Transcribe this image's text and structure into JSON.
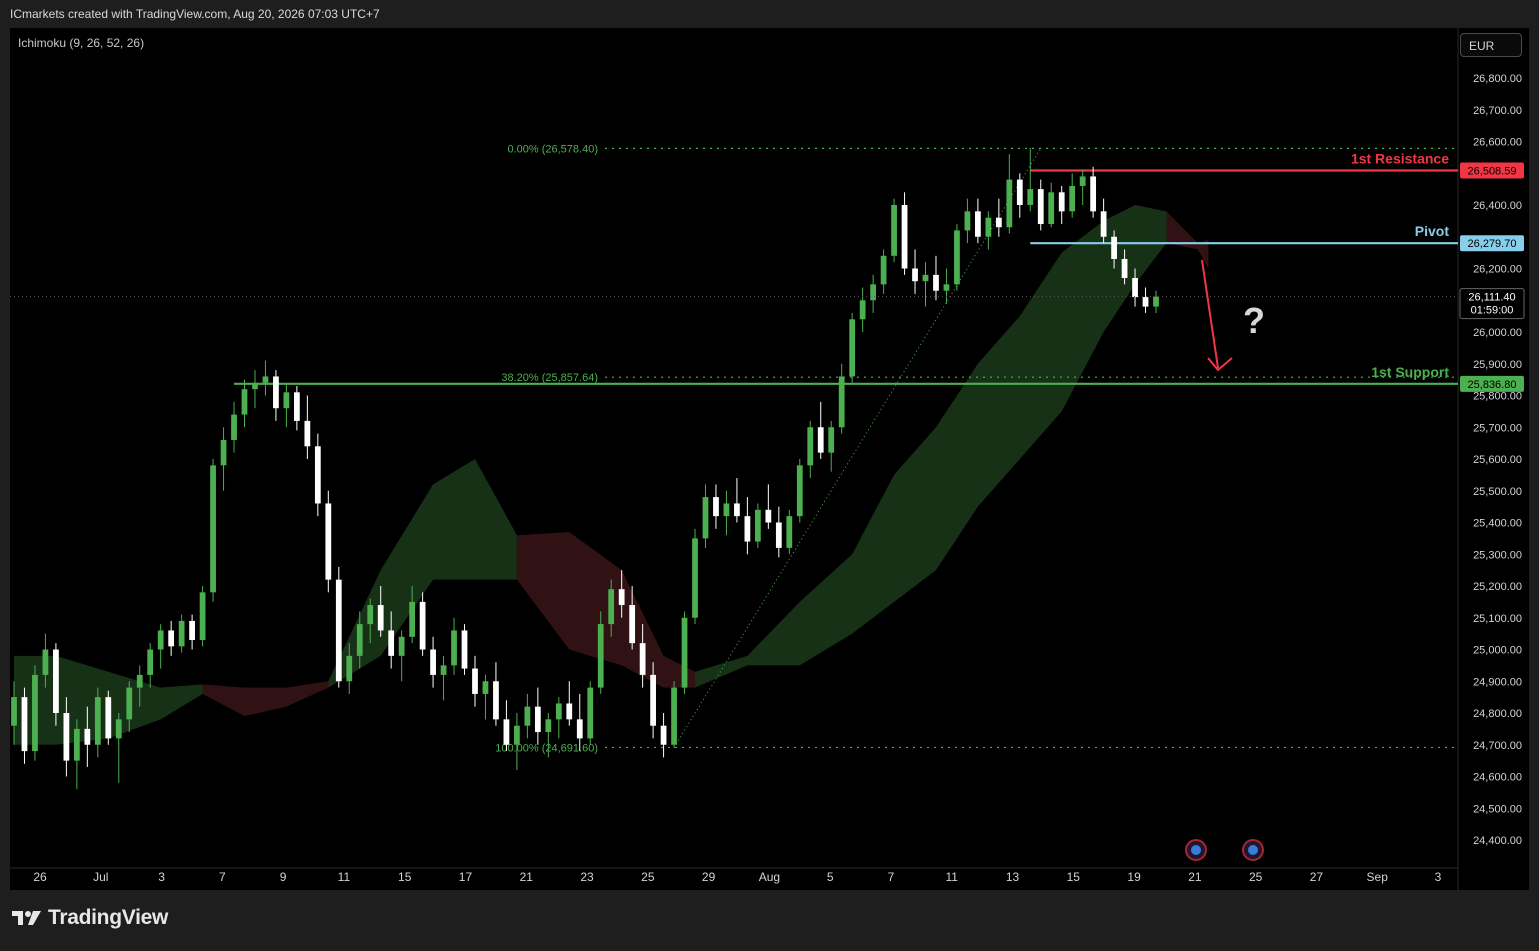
{
  "header": {
    "attribution": "ICmarkets created with TradingView.com, Aug 20, 2026 07:03 UTC+7",
    "indicator": "Ichimoku (9, 26, 52, 26)",
    "currency": "EUR"
  },
  "footer": {
    "brand": "TradingView"
  },
  "colors": {
    "up": "#4caf50",
    "down": "#ffffff",
    "resistance": "#f23645",
    "pivot": "#87ceeb",
    "support": "#4caf50",
    "fib": "#4caf50",
    "cloud_bull": "#1b3a1b",
    "cloud_bear": "#3a1518",
    "arrow": "#f23645"
  },
  "chart_data": {
    "type": "candlestick",
    "y_axis": {
      "ylim": [
        24300,
        26900
      ],
      "ticks": [
        24400,
        24500,
        24600,
        24700,
        24800,
        24900,
        25000,
        25100,
        25200,
        25300,
        25400,
        25500,
        25600,
        25700,
        25800,
        25900,
        26000,
        26100,
        26200,
        26300,
        26400,
        26500,
        26600,
        26700,
        26800
      ]
    },
    "x_axis": {
      "tick_labels": [
        "26",
        "Jul",
        "3",
        "7",
        "9",
        "11",
        "15",
        "17",
        "21",
        "23",
        "25",
        "29",
        "Aug",
        "5",
        "7",
        "11",
        "13",
        "15",
        "19",
        "21",
        "25",
        "27",
        "Sep",
        "3"
      ]
    },
    "levels": [
      {
        "label": "1st Resistance",
        "value": 26508.59,
        "value_text": "26,508.59"
      },
      {
        "label": "Pivot",
        "value": 26279.7,
        "value_text": "26,279.70"
      },
      {
        "label": "1st Support",
        "value": 25836.8,
        "value_text": "25,836.80"
      }
    ],
    "fibonacci": [
      {
        "label": "0.00% (26,578.40)",
        "value": 26578.4
      },
      {
        "label": "38.20% (25,857.64)",
        "value": 25857.64
      },
      {
        "label": "100.00% (24,691.60)",
        "value": 24691.6
      }
    ],
    "last_price": {
      "value": 26111.4,
      "value_text": "26,111.40",
      "countdown": "01:59:00"
    },
    "annotation": "?",
    "candles": [
      [
        24760,
        24900,
        24700,
        24850
      ],
      [
        24850,
        24880,
        24640,
        24680
      ],
      [
        24680,
        24950,
        24650,
        24920
      ],
      [
        24920,
        25050,
        24880,
        25000
      ],
      [
        25000,
        25020,
        24760,
        24800
      ],
      [
        24800,
        24850,
        24600,
        24650
      ],
      [
        24650,
        24780,
        24560,
        24750
      ],
      [
        24750,
        24820,
        24630,
        24700
      ],
      [
        24700,
        24880,
        24660,
        24850
      ],
      [
        24850,
        24870,
        24700,
        24720
      ],
      [
        24720,
        24800,
        24580,
        24780
      ],
      [
        24780,
        24900,
        24740,
        24880
      ],
      [
        24880,
        24950,
        24820,
        24920
      ],
      [
        24920,
        25020,
        24880,
        25000
      ],
      [
        25000,
        25080,
        24940,
        25060
      ],
      [
        25060,
        25090,
        24980,
        25010
      ],
      [
        25010,
        25110,
        24990,
        25090
      ],
      [
        25090,
        25110,
        25000,
        25030
      ],
      [
        25030,
        25200,
        25010,
        25180
      ],
      [
        25180,
        25600,
        25150,
        25580
      ],
      [
        25580,
        25700,
        25500,
        25660
      ],
      [
        25660,
        25780,
        25620,
        25740
      ],
      [
        25740,
        25850,
        25700,
        25820
      ],
      [
        25820,
        25880,
        25760,
        25840
      ],
      [
        25840,
        25910,
        25800,
        25860
      ],
      [
        25860,
        25880,
        25720,
        25760
      ],
      [
        25760,
        25840,
        25700,
        25810
      ],
      [
        25810,
        25830,
        25690,
        25720
      ],
      [
        25720,
        25800,
        25600,
        25640
      ],
      [
        25640,
        25680,
        25420,
        25460
      ],
      [
        25460,
        25500,
        25180,
        25220
      ],
      [
        25220,
        25260,
        24880,
        24900
      ],
      [
        24900,
        25020,
        24860,
        24980
      ],
      [
        24980,
        25120,
        24940,
        25080
      ],
      [
        25080,
        25160,
        25020,
        25140
      ],
      [
        25140,
        25200,
        25040,
        25060
      ],
      [
        25060,
        25120,
        24940,
        24980
      ],
      [
        24980,
        25060,
        24900,
        25040
      ],
      [
        25040,
        25200,
        25020,
        25150
      ],
      [
        25150,
        25180,
        24980,
        25000
      ],
      [
        25000,
        25040,
        24880,
        24920
      ],
      [
        24920,
        24980,
        24840,
        24950
      ],
      [
        24950,
        25100,
        24920,
        25060
      ],
      [
        25060,
        25080,
        24920,
        24940
      ],
      [
        24940,
        24980,
        24820,
        24860
      ],
      [
        24860,
        24920,
        24780,
        24900
      ],
      [
        24900,
        24960,
        24760,
        24780
      ],
      [
        24780,
        24840,
        24680,
        24700
      ],
      [
        24700,
        24800,
        24620,
        24760
      ],
      [
        24760,
        24860,
        24720,
        24820
      ],
      [
        24820,
        24880,
        24700,
        24740
      ],
      [
        24740,
        24800,
        24660,
        24780
      ],
      [
        24780,
        24850,
        24720,
        24830
      ],
      [
        24830,
        24900,
        24760,
        24780
      ],
      [
        24780,
        24860,
        24680,
        24720
      ],
      [
        24720,
        24900,
        24700,
        24880
      ],
      [
        24880,
        25120,
        24860,
        25080
      ],
      [
        25080,
        25220,
        25040,
        25190
      ],
      [
        25190,
        25250,
        25100,
        25140
      ],
      [
        25140,
        25200,
        25000,
        25020
      ],
      [
        25020,
        25080,
        24880,
        24920
      ],
      [
        24920,
        24960,
        24720,
        24760
      ],
      [
        24760,
        24800,
        24660,
        24700
      ],
      [
        24700,
        24900,
        24690,
        24880
      ],
      [
        24880,
        25120,
        24860,
        25100
      ],
      [
        25100,
        25380,
        25080,
        25350
      ],
      [
        25350,
        25520,
        25320,
        25480
      ],
      [
        25480,
        25520,
        25380,
        25420
      ],
      [
        25420,
        25500,
        25360,
        25460
      ],
      [
        25460,
        25540,
        25400,
        25420
      ],
      [
        25420,
        25480,
        25300,
        25340
      ],
      [
        25340,
        25460,
        25320,
        25440
      ],
      [
        25440,
        25520,
        25380,
        25400
      ],
      [
        25400,
        25450,
        25290,
        25320
      ],
      [
        25320,
        25440,
        25300,
        25420
      ],
      [
        25420,
        25600,
        25400,
        25580
      ],
      [
        25580,
        25720,
        25540,
        25700
      ],
      [
        25700,
        25780,
        25600,
        25620
      ],
      [
        25620,
        25720,
        25560,
        25700
      ],
      [
        25700,
        25900,
        25680,
        25860
      ],
      [
        25860,
        26060,
        25840,
        26040
      ],
      [
        26040,
        26140,
        26000,
        26100
      ],
      [
        26100,
        26180,
        26060,
        26150
      ],
      [
        26150,
        26260,
        26120,
        26240
      ],
      [
        26240,
        26420,
        26220,
        26400
      ],
      [
        26400,
        26440,
        26180,
        26200
      ],
      [
        26200,
        26260,
        26120,
        26160
      ],
      [
        26160,
        26220,
        26080,
        26180
      ],
      [
        26180,
        26240,
        26100,
        26130
      ],
      [
        26130,
        26200,
        26090,
        26150
      ],
      [
        26150,
        26340,
        26130,
        26320
      ],
      [
        26320,
        26420,
        26280,
        26380
      ],
      [
        26380,
        26420,
        26280,
        26300
      ],
      [
        26300,
        26380,
        26260,
        26360
      ],
      [
        26360,
        26420,
        26300,
        26330
      ],
      [
        26330,
        26560,
        26310,
        26480
      ],
      [
        26480,
        26500,
        26360,
        26400
      ],
      [
        26400,
        26580,
        26380,
        26450
      ],
      [
        26450,
        26480,
        26320,
        26340
      ],
      [
        26340,
        26470,
        26330,
        26440
      ],
      [
        26440,
        26460,
        26340,
        26380
      ],
      [
        26380,
        26500,
        26360,
        26460
      ],
      [
        26460,
        26510,
        26400,
        26490
      ],
      [
        26490,
        26520,
        26360,
        26380
      ],
      [
        26380,
        26420,
        26280,
        26300
      ],
      [
        26300,
        26320,
        26200,
        26230
      ],
      [
        26230,
        26260,
        26150,
        26170
      ],
      [
        26170,
        26200,
        26080,
        26110
      ],
      [
        26110,
        26140,
        26060,
        26080
      ],
      [
        26080,
        26130,
        26060,
        26111.4
      ]
    ]
  }
}
